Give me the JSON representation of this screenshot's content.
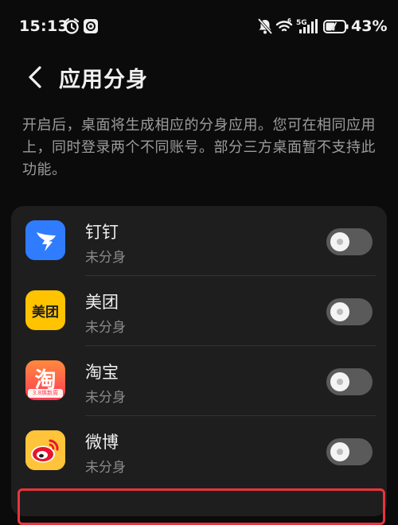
{
  "status_bar": {
    "time": "15:13",
    "battery": "43%",
    "network": "5G"
  },
  "header": {
    "title": "应用分身"
  },
  "description": "开启后，桌面将生成相应的分身应用。您可在相同应用上，同时登录两个不同账号。部分三方桌面暂不支持此功能。",
  "apps": [
    {
      "name": "钉钉",
      "status": "未分身",
      "enabled": false,
      "icon": "dingtalk-icon",
      "color": "#3d7bff"
    },
    {
      "name": "美团",
      "status": "未分身",
      "enabled": false,
      "icon": "meituan-icon",
      "color": "#ffc300",
      "icon_text": "美团"
    },
    {
      "name": "淘宝",
      "status": "未分身",
      "enabled": false,
      "icon": "taobao-icon",
      "color": "#ff4d2e",
      "icon_text": "淘",
      "icon_subtext": "3.8焕新周"
    },
    {
      "name": "微博",
      "status": "未分身",
      "enabled": false,
      "icon": "weibo-icon",
      "color": "#e6162d"
    }
  ]
}
